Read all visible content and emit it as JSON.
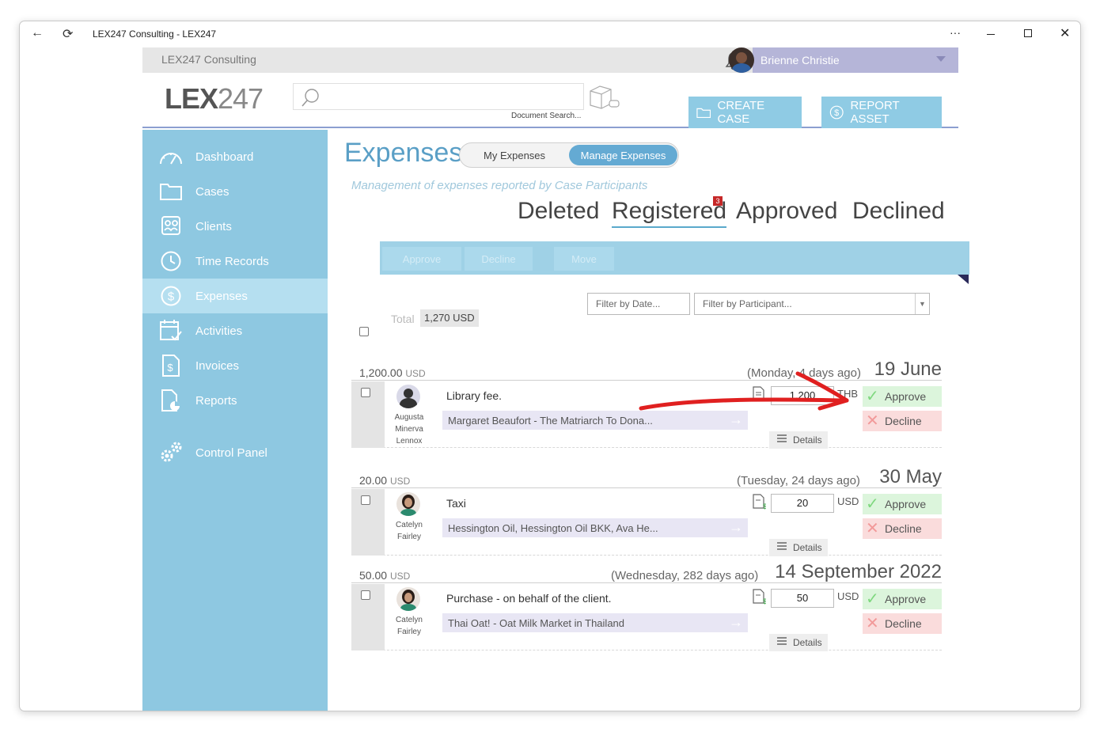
{
  "window": {
    "title": "LEX247 Consulting - LEX247",
    "more_label": "···"
  },
  "topbar": {
    "org_name": "LEX247 Consulting",
    "user_name": "Brienne Christie"
  },
  "header": {
    "logo_text": "LEX",
    "logo_number": "247",
    "search_placeholder": "",
    "search_caption": "Document Search...",
    "create_case_label": "CREATE CASE",
    "report_asset_label": "REPORT ASSET"
  },
  "sidebar": {
    "items": [
      {
        "label": "Dashboard",
        "icon": "gauge-icon",
        "active": false
      },
      {
        "label": "Cases",
        "icon": "folder-icon",
        "active": false
      },
      {
        "label": "Clients",
        "icon": "contacts-icon",
        "active": false
      },
      {
        "label": "Time Records",
        "icon": "clock-icon",
        "active": false
      },
      {
        "label": "Expenses",
        "icon": "dollar-circle-icon",
        "active": true
      },
      {
        "label": "Activities",
        "icon": "calendar-check-icon",
        "active": false
      },
      {
        "label": "Invoices",
        "icon": "invoice-icon",
        "active": false
      },
      {
        "label": "Reports",
        "icon": "report-icon",
        "active": false
      },
      {
        "label": "Control Panel",
        "icon": "gears-icon",
        "active": false
      }
    ]
  },
  "page": {
    "title": "Expenses",
    "toggle": {
      "my_label": "My Expenses",
      "manage_label": "Manage Expenses",
      "selected": "Manage Expenses"
    },
    "subtitle": "Management of expenses reported by Case Participants",
    "tabs": [
      {
        "label": "Deleted",
        "active": false
      },
      {
        "label": "Registered",
        "active": true,
        "badge": "3"
      },
      {
        "label": "Approved",
        "active": false
      },
      {
        "label": "Declined",
        "active": false
      }
    ],
    "actions": {
      "approve": "Approve",
      "decline": "Decline",
      "move": "Move"
    },
    "filters": {
      "date_placeholder": "Filter by Date...",
      "participant_placeholder": "Filter by Participant..."
    },
    "total_label": "Total",
    "total_value": "1,270 USD"
  },
  "expenses": [
    {
      "amount": "1,200.00",
      "currency": "USD",
      "ago": "(Monday, 4 days ago)",
      "date": "19 June",
      "participant_line1": "Augusta",
      "participant_line2": "Minerva",
      "participant_line3": "Lennox",
      "description": "Library fee.",
      "case": "Margaret Beaufort - The Matriarch To Dona...",
      "input_amount": "1,200",
      "input_currency": "THB",
      "approve": "Approve",
      "decline": "Decline",
      "details": "Details"
    },
    {
      "amount": "20.00",
      "currency": "USD",
      "ago": "(Tuesday, 24 days ago)",
      "date": "30 May",
      "participant_line1": "Catelyn",
      "participant_line2": "Fairley",
      "participant_line3": "",
      "description": "Taxi",
      "case": "Hessington Oil, Hessington Oil BKK, Ava He...",
      "input_amount": "20",
      "input_currency": "USD",
      "approve": "Approve",
      "decline": "Decline",
      "details": "Details"
    },
    {
      "amount": "50.00",
      "currency": "USD",
      "ago": "(Wednesday, 282 days ago)",
      "date": "14 September 2022",
      "participant_line1": "Catelyn",
      "participant_line2": "Fairley",
      "participant_line3": "",
      "description": "Purchase - on behalf of the client.",
      "case": "Thai Oat! - Oat Milk Market in Thailand",
      "input_amount": "50",
      "input_currency": "USD",
      "approve": "Approve",
      "decline": "Decline",
      "details": "Details"
    }
  ],
  "colors": {
    "sidebar": "#8ec8e1",
    "sidebar_active": "#b5dff0",
    "accent": "#5aa9cc",
    "approve_bg": "#dcf5dc",
    "decline_bg": "#fadcdc",
    "annotation_arrow": "#e02020"
  }
}
